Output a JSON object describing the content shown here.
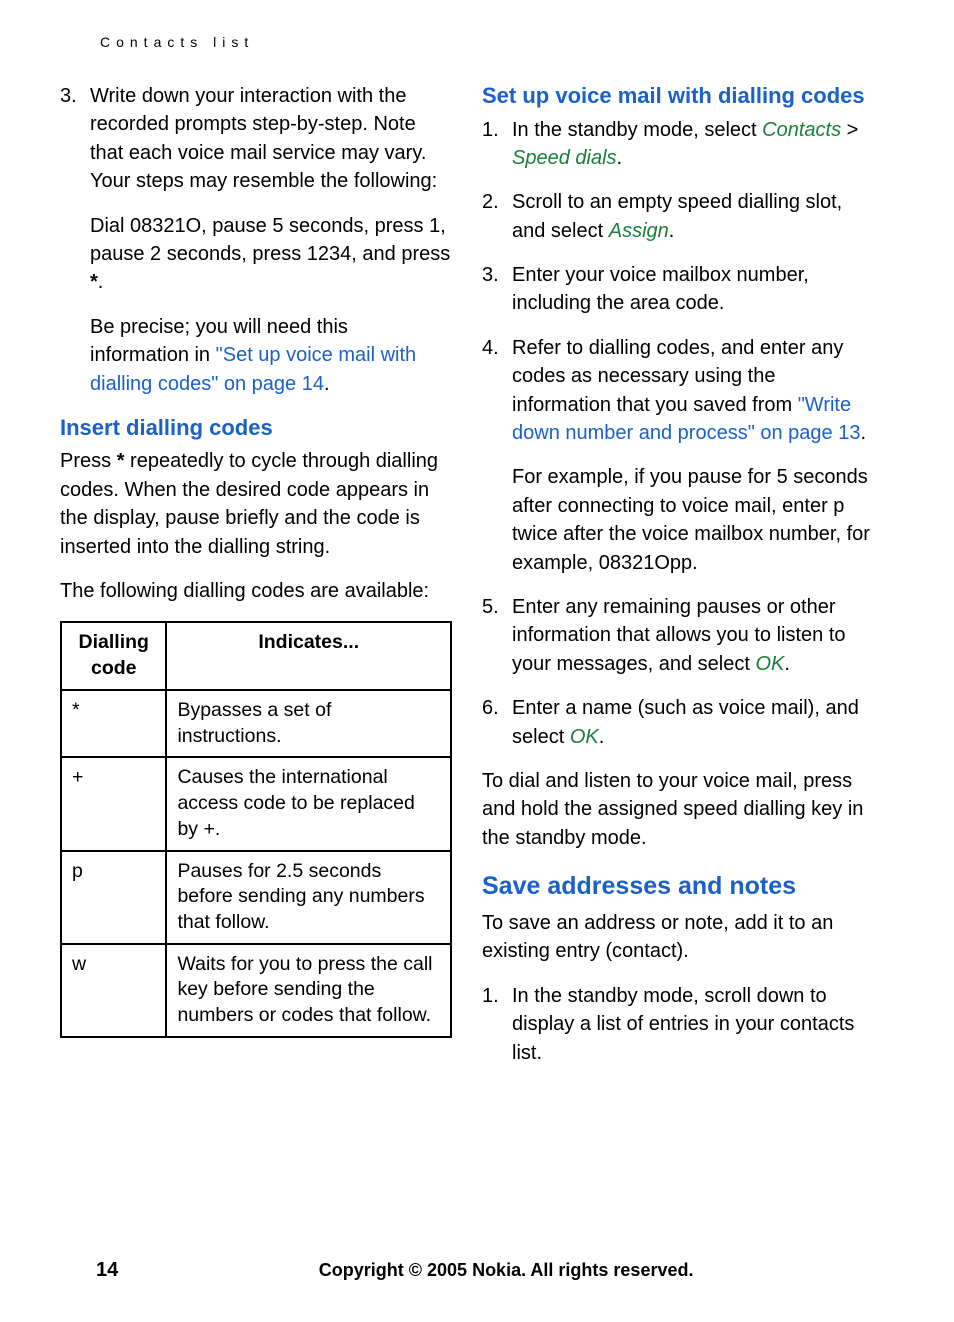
{
  "runningHead": "Contacts list",
  "left": {
    "ol3": {
      "num": "3.",
      "text_a": "Write down your interaction with the recorded prompts step-by-step. Note that each voice mail service may vary. Your steps may resemble the following:",
      "sub1": "Dial 08321O, pause 5 seconds, press 1, pause 2 seconds, press 1234, and press ",
      "sub1_bold": "*",
      "sub1_tail": ".",
      "sub2_a": "Be precise; you will need this information in ",
      "sub2_link": "\"Set up voice mail with dialling codes\" on page 14",
      "sub2_tail": "."
    },
    "h_insert": "Insert dialling codes",
    "insert_p1_a": "Press ",
    "insert_p1_bold": "*",
    "insert_p1_b": " repeatedly to cycle through dialling codes. When the desired code appears in the display, pause briefly and the code is inserted into the dialling string.",
    "insert_p2": "The following dialling codes are available:",
    "table": {
      "th1": "Dialling code",
      "th2": "Indicates...",
      "rows": [
        {
          "c": "*",
          "d": "Bypasses a set of instructions."
        },
        {
          "c": "+",
          "d": "Causes the international access code to be replaced by +."
        },
        {
          "c": "p",
          "d": "Pauses for 2.5 seconds before sending any numbers that follow."
        },
        {
          "c": "w",
          "d": "Waits for you to press the call key before sending the numbers or codes that follow."
        }
      ]
    }
  },
  "right": {
    "h_setup": "Set up voice mail with dialling codes",
    "ol": {
      "i1": {
        "num": "1.",
        "a": "In the standby mode, select ",
        "ui1": "Contacts",
        "sep": " > ",
        "ui2": "Speed dials",
        "tail": "."
      },
      "i2": {
        "num": "2.",
        "a": "Scroll to an empty speed dialling slot, and select ",
        "ui": "Assign",
        "tail": "."
      },
      "i3": {
        "num": "3.",
        "a": "Enter your voice mailbox number, including the area code."
      },
      "i4": {
        "num": "4.",
        "a": "Refer to dialling codes, and enter any codes as necessary using the information that you saved from ",
        "link": "\"Write down number and process\" on page 13",
        "tail": ".",
        "sub": "For example, if you pause for 5 seconds after connecting to voice mail, enter p twice after the voice mailbox number, for example, 08321Opp."
      },
      "i5": {
        "num": "5.",
        "a": "Enter any remaining pauses or other information that allows you to listen to your messages, and select ",
        "ui": "OK",
        "tail": "."
      },
      "i6": {
        "num": "6.",
        "a": "Enter a name (such as voice mail), and select ",
        "ui": "OK",
        "tail": "."
      }
    },
    "para_after": "To dial and listen to your voice mail, press and hold the assigned speed dialling key in the standby mode.",
    "h_save": "Save addresses and notes",
    "save_p": "To save an address or note, add it to an existing entry (contact).",
    "save_ol": {
      "num": "1.",
      "a": "In the standby mode, scroll down to display a list of entries in your contacts list."
    }
  },
  "footer": {
    "page": "14",
    "copyright": "Copyright © 2005 Nokia. All rights reserved."
  }
}
